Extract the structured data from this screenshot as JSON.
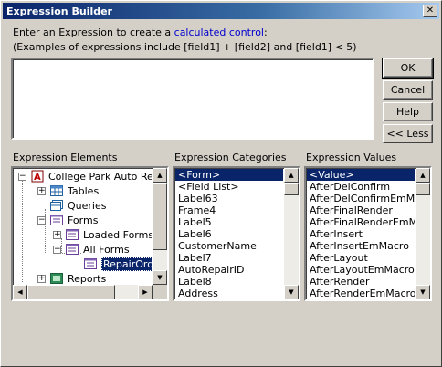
{
  "window": {
    "title": "Expression Builder"
  },
  "intro": {
    "line1_prefix": "Enter an Expression to create a ",
    "line1_link": "calculated control",
    "line1_suffix": ":",
    "line2": "(Examples of expressions include [field1] + [field2] and [field1] < 5)"
  },
  "expression": {
    "value": ""
  },
  "buttons": {
    "ok": "OK",
    "cancel": "Cancel",
    "help": "Help",
    "less": "<< Less",
    "close": "✕"
  },
  "sections": {
    "elements": "Expression Elements",
    "categories": "Expression Categories",
    "values": "Expression Values"
  },
  "tree": {
    "root": "College Park Auto Repa",
    "tables": "Tables",
    "queries": "Queries",
    "forms": "Forms",
    "loaded_forms": "Loaded Forms",
    "all_forms": "All Forms",
    "repair_orders": "RepairOrde",
    "reports": "Reports"
  },
  "categories": [
    "<Form>",
    "<Field List>",
    "Label63",
    "Frame4",
    "Label5",
    "Label6",
    "CustomerName",
    "Label7",
    "AutoRepairID",
    "Label8",
    "Address"
  ],
  "selected_category": "<Form>",
  "values": [
    "<Value>",
    "AfterDelConfirm",
    "AfterDelConfirmEmMacro",
    "AfterFinalRender",
    "AfterFinalRenderEmMacro",
    "AfterInsert",
    "AfterInsertEmMacro",
    "AfterLayout",
    "AfterLayoutEmMacro",
    "AfterRender",
    "AfterRenderEmMacro"
  ],
  "selected_value": "<Value>",
  "colors": {
    "selection": "#0a246a",
    "face": "#d4d0c8",
    "link": "#0000cc"
  }
}
